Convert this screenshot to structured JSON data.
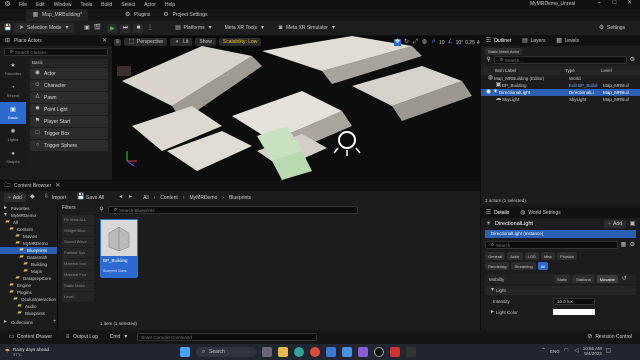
{
  "title_bar": {
    "project": "MyMRDemo_Unreal"
  },
  "tabs": {
    "level": "Map_MRBuilding*",
    "plugins": "Plugins",
    "project_settings": "Project Settings"
  },
  "menu": [
    "File",
    "Edit",
    "Window",
    "Tools",
    "Build",
    "Select",
    "Actor",
    "Help"
  ],
  "toolbar": {
    "selection_mode": "Selection Mode",
    "platforms": "Platforms",
    "meta_xr_tools": "Meta XR Tools",
    "meta_xr_simulator": "Meta XR Simulator",
    "settings": "Settings"
  },
  "viewport": {
    "perspective": "Perspective",
    "lit": "Lit",
    "show": "Show",
    "scalability": "Scalability: Low",
    "snap": "10",
    "rot_snap": "10°",
    "scale_snap": "0.25",
    "cam_speed": "4"
  },
  "place_actors": {
    "title": "Place Actors",
    "search_placeholder": "Search Classes",
    "section": "Basic",
    "items": [
      "Actor",
      "Character",
      "Pawn",
      "Point Light",
      "Player Start",
      "Trigger Box",
      "Trigger Sphere"
    ],
    "rail": [
      "Favorites",
      "Recent",
      "Basic",
      "Lights",
      "",
      "Shapes",
      "",
      "Visual"
    ]
  },
  "outliner": {
    "tab_outliner": "Outliner",
    "tab_layers": "Layers",
    "tab_levels": "Levels",
    "filter_chip": "Static Mesh Actor",
    "search_placeholder": "Search...",
    "col_label": "Item Label",
    "col_type": "Type",
    "col_level": "Level",
    "rows": [
      {
        "label": "Map_MRBuilding (Editor)",
        "type": "World",
        "level": ""
      },
      {
        "label": "BP_Building",
        "type": "Edit BP_Buildi",
        "level": "Map_MRBuil"
      },
      {
        "label": "DirectionalLight",
        "type": "DirectionalLi",
        "level": "Map_MRBuil"
      },
      {
        "label": "SkyLight",
        "type": "SkyLight",
        "level": "Map_MRBuil"
      }
    ],
    "status": "3 actors (1 selected)"
  },
  "content_browser": {
    "title": "Content Browser",
    "add": "Add",
    "import": "Import",
    "save_all": "Save All",
    "breadcrumb": [
      "All",
      "Content",
      "MyMRDemo",
      "Blueprints"
    ],
    "favorites": "Favorites",
    "project": "MyMRDemo",
    "tree": [
      "All",
      "Content",
      "Movies",
      "MyMRDemo",
      "Blueprints",
      "Datasmith",
      "Building",
      "Maps",
      "DataprepCore",
      "Engine",
      "Plugins",
      "OculusInteraction",
      "Audio",
      "Blueprints"
    ],
    "filters_title": "Filters",
    "filters": [
      "Fb View ALL",
      "Widget Blue",
      "Sound Wave",
      "Particle Sys",
      "Material Inst",
      "Material Fun",
      "Static Mesh",
      "Level"
    ],
    "search_placeholder": "Search Blueprints",
    "asset_name": "BP_Building",
    "asset_type": "Blueprint Class",
    "status": "1 item (1 selected)",
    "collections": "Collections"
  },
  "details": {
    "tab_details": "Details",
    "tab_world": "World Settings",
    "object": "DirectionalLight",
    "add": "Add",
    "instance": "DirectionalLight (Instance)",
    "search_placeholder": "Search",
    "chips_row1": [
      "General",
      "Actor",
      "LOD",
      "Misc",
      "Physics"
    ],
    "chips_row2": [
      "Rendering",
      "Streaming",
      "All"
    ],
    "mobility_label": "Mobility",
    "mobility": [
      "Static",
      "Stationa",
      "Movable"
    ],
    "light_section": "Light",
    "intensity_label": "Intensity",
    "intensity": "10.0 lux",
    "light_color_label": "Light Color"
  },
  "bottom_bar": {
    "content_drawer": "Content Drawer",
    "output_log": "Output Log",
    "cmd": "Cmd",
    "console_placeholder": "Enter Console Command",
    "revision": "Revision Control"
  },
  "taskbar": {
    "weather": "Rainy days ahead",
    "temp": "37°C",
    "search": "Search",
    "lang": "ENG",
    "time": "10:55 AM",
    "date": "9/4/2023"
  }
}
